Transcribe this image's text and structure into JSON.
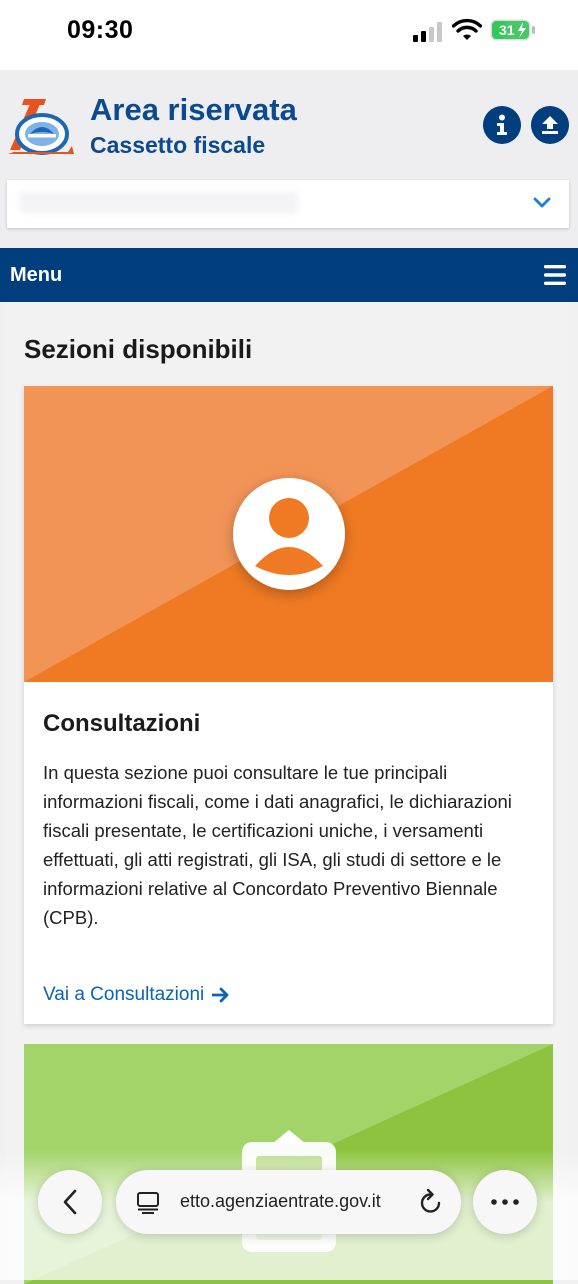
{
  "status_bar": {
    "time": "09:30",
    "battery": "31",
    "icons": [
      "signal-icon",
      "wifi-icon",
      "battery-charging-icon"
    ]
  },
  "header": {
    "title": "Area riservata",
    "subtitle": "Cassetto fiscale",
    "logo_icon": "agenzia-entrate-logo",
    "info_icon": "info-icon",
    "upload_icon": "upload-icon",
    "select_icon": "chevron-down-icon"
  },
  "menu": {
    "label": "Menu",
    "icon": "hamburger-icon"
  },
  "main": {
    "section_title": "Sezioni disponibili",
    "cards": [
      {
        "title": "Consultazioni",
        "description": "In questa sezione puoi consultare le tue principali informazioni fiscali, come i dati anagrafici, le dichiarazioni fiscali presentate, le certificazioni uniche, i versamenti effettuati, gli atti registrati, gli ISA, gli studi di settore e le informazioni relative al Concordato Preventivo Biennale (CPB).",
        "link": "Vai a Consultazioni",
        "icon": "user-icon",
        "color": "#f07a23"
      },
      {
        "icon": "clipboard-icon",
        "color": "#8cc43f"
      }
    ]
  },
  "browser": {
    "url": "etto.agenziaentrate.gov.it",
    "icons": [
      "back-arrow-icon",
      "tabs-icon",
      "reload-icon",
      "more-icon"
    ]
  },
  "colors": {
    "brand_blue": "#003e7e",
    "link_blue": "#0b63b5",
    "orange": "#f07a23",
    "green": "#8cc43f"
  }
}
